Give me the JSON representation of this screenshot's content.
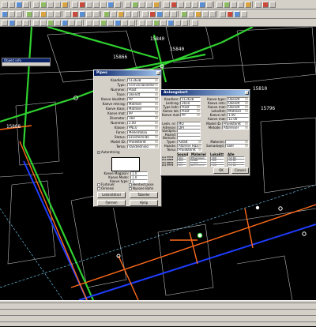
{
  "canvas_labels": {
    "top_num_1": "15840",
    "top_num_2": "15840",
    "top_num_3": "15866",
    "left_num": "15808",
    "right_num": "15810",
    "mid_num": "15796"
  },
  "mini_window": {
    "title": "Objekt info"
  },
  "left_dialog": {
    "title": "Pipes",
    "rows": [
      {
        "label": "Kaadlenr:",
        "value": "513638"
      },
      {
        "label": "Type:",
        "value": "Forsyningsledning"
      },
      {
        "label": "Nummer:",
        "value": "Plast"
      },
      {
        "label": "Trace:",
        "value": "Ukendt"
      },
      {
        "label": "Kaeve lokalitet:",
        "value": "PP"
      },
      {
        "label": "Kaeve retning:",
        "value": "Matrikel"
      },
      {
        "label": "Kaeve klass:",
        "value": "Matrikel"
      },
      {
        "label": "Kaeve mat:",
        "value": "PP"
      },
      {
        "label": "Diameter:",
        "value": "160"
      },
      {
        "label": "Nummer:",
        "value": "2.00"
      },
      {
        "label": "Klasse:",
        "value": "PN10"
      },
      {
        "label": "Farve:",
        "value": "Mellemblaa"
      },
      {
        "label": "Status:",
        "value": "Eksisterende"
      },
      {
        "label": "Model ID:",
        "value": "Projekteret"
      },
      {
        "label": "Tema:",
        "value": "Vandledning"
      }
    ],
    "checkbox_autoretning": "Autoretning",
    "side_labels": [
      "Kaeve Magasin:",
      "Kaeve Mode:",
      "Kaeve type:"
    ],
    "side_values": [
      "1.0",
      "1.0",
      "1"
    ],
    "options": [
      "Forbruer",
      "Oimensi",
      "Vandro",
      "Tykke"
    ],
    "options2": [
      "Hentestrasse",
      "Nysone Bahn"
    ],
    "buttons": [
      "Ledsnitktrol",
      "Tabeller",
      "Fjernen",
      "Hjelp"
    ]
  },
  "right_dialog": {
    "title": "Anlaegskort",
    "rows_left": [
      {
        "label": "Kaadlenr:",
        "value": "513638"
      },
      {
        "label": "Ledning:",
        "value": "2650"
      },
      {
        "label": "Type ledn:",
        "value": "Plast"
      },
      {
        "label": "Kaeve lok:",
        "value": "Plast"
      },
      {
        "label": "Kaeve mat:",
        "value": "PP"
      }
    ],
    "rows_right": [
      {
        "label": "Kaeve type:",
        "value": "Ukendt"
      },
      {
        "label": "Kaeve retn:",
        "value": "Ukendt"
      },
      {
        "label": "Kaeve mat:",
        "value": "Ukendt"
      },
      {
        "label": "Lokalitet:",
        "value": "Matrikel"
      },
      {
        "label": "Kaeve ref:",
        "value": "1.00"
      },
      {
        "label": "Kaeve mat:",
        "value": "12.00"
      }
    ],
    "mid_rows": [
      {
        "label": "Ledn. nr:",
        "value": "MO"
      },
      {
        "label": "Adresse:",
        "value": "QPT"
      },
      {
        "label": "Vandpris:",
        "value": ""
      },
      {
        "label": "Haand:",
        "value": ""
      },
      {
        "label": "Bemark:",
        "value": ""
      }
    ],
    "mid_right": [
      {
        "label": "Model ID:",
        "value": "Projekteret"
      },
      {
        "label": "Metode:",
        "value": "Afgrenser"
      }
    ],
    "type_rows": [
      {
        "label": "Typer:",
        "value": "Asfalt"
      },
      {
        "label": "Haaste:",
        "value": "Afgrene Haastidt"
      },
      {
        "label": "Tema:",
        "value": "Projekteret"
      }
    ],
    "type_right": [
      {
        "label": "Materiel:",
        "value": ""
      },
      {
        "label": "Samarbejd:",
        "value": "Sael"
      }
    ],
    "table_headers": [
      "Sound",
      "Materiel",
      "Lokalitt",
      "Alle"
    ],
    "table_rows": [
      [
        "(1) TTTT",
        "Ukn",
        "Polypropen",
        "100",
        "12.00"
      ],
      [
        "(2) 2203",
        "Ukn",
        "Asfalt",
        "100",
        "12.00"
      ],
      [
        "(3) 2044",
        "Ukn",
        "Asfalt",
        "100",
        "12.00"
      ],
      [
        "(4) TTTT",
        "Ukn",
        "Polypropen",
        "100",
        "12.00"
      ]
    ],
    "ok_label": "OK",
    "cancel_label": "Cancel"
  },
  "status": {
    "rows": [
      [
        "",
        "",
        "",
        ""
      ],
      [
        "",
        "",
        "",
        ""
      ],
      [
        "",
        "",
        "",
        ""
      ]
    ]
  }
}
